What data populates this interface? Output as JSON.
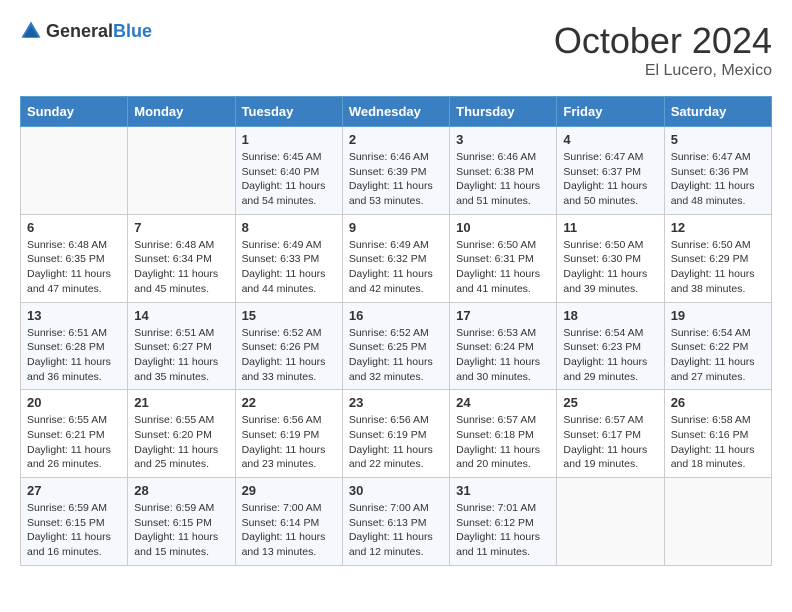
{
  "logo": {
    "text_general": "General",
    "text_blue": "Blue"
  },
  "header": {
    "month": "October 2024",
    "location": "El Lucero, Mexico"
  },
  "weekdays": [
    "Sunday",
    "Monday",
    "Tuesday",
    "Wednesday",
    "Thursday",
    "Friday",
    "Saturday"
  ],
  "weeks": [
    [
      {
        "day": "",
        "info": ""
      },
      {
        "day": "",
        "info": ""
      },
      {
        "day": "1",
        "info": "Sunrise: 6:45 AM\nSunset: 6:40 PM\nDaylight: 11 hours and 54 minutes."
      },
      {
        "day": "2",
        "info": "Sunrise: 6:46 AM\nSunset: 6:39 PM\nDaylight: 11 hours and 53 minutes."
      },
      {
        "day": "3",
        "info": "Sunrise: 6:46 AM\nSunset: 6:38 PM\nDaylight: 11 hours and 51 minutes."
      },
      {
        "day": "4",
        "info": "Sunrise: 6:47 AM\nSunset: 6:37 PM\nDaylight: 11 hours and 50 minutes."
      },
      {
        "day": "5",
        "info": "Sunrise: 6:47 AM\nSunset: 6:36 PM\nDaylight: 11 hours and 48 minutes."
      }
    ],
    [
      {
        "day": "6",
        "info": "Sunrise: 6:48 AM\nSunset: 6:35 PM\nDaylight: 11 hours and 47 minutes."
      },
      {
        "day": "7",
        "info": "Sunrise: 6:48 AM\nSunset: 6:34 PM\nDaylight: 11 hours and 45 minutes."
      },
      {
        "day": "8",
        "info": "Sunrise: 6:49 AM\nSunset: 6:33 PM\nDaylight: 11 hours and 44 minutes."
      },
      {
        "day": "9",
        "info": "Sunrise: 6:49 AM\nSunset: 6:32 PM\nDaylight: 11 hours and 42 minutes."
      },
      {
        "day": "10",
        "info": "Sunrise: 6:50 AM\nSunset: 6:31 PM\nDaylight: 11 hours and 41 minutes."
      },
      {
        "day": "11",
        "info": "Sunrise: 6:50 AM\nSunset: 6:30 PM\nDaylight: 11 hours and 39 minutes."
      },
      {
        "day": "12",
        "info": "Sunrise: 6:50 AM\nSunset: 6:29 PM\nDaylight: 11 hours and 38 minutes."
      }
    ],
    [
      {
        "day": "13",
        "info": "Sunrise: 6:51 AM\nSunset: 6:28 PM\nDaylight: 11 hours and 36 minutes."
      },
      {
        "day": "14",
        "info": "Sunrise: 6:51 AM\nSunset: 6:27 PM\nDaylight: 11 hours and 35 minutes."
      },
      {
        "day": "15",
        "info": "Sunrise: 6:52 AM\nSunset: 6:26 PM\nDaylight: 11 hours and 33 minutes."
      },
      {
        "day": "16",
        "info": "Sunrise: 6:52 AM\nSunset: 6:25 PM\nDaylight: 11 hours and 32 minutes."
      },
      {
        "day": "17",
        "info": "Sunrise: 6:53 AM\nSunset: 6:24 PM\nDaylight: 11 hours and 30 minutes."
      },
      {
        "day": "18",
        "info": "Sunrise: 6:54 AM\nSunset: 6:23 PM\nDaylight: 11 hours and 29 minutes."
      },
      {
        "day": "19",
        "info": "Sunrise: 6:54 AM\nSunset: 6:22 PM\nDaylight: 11 hours and 27 minutes."
      }
    ],
    [
      {
        "day": "20",
        "info": "Sunrise: 6:55 AM\nSunset: 6:21 PM\nDaylight: 11 hours and 26 minutes."
      },
      {
        "day": "21",
        "info": "Sunrise: 6:55 AM\nSunset: 6:20 PM\nDaylight: 11 hours and 25 minutes."
      },
      {
        "day": "22",
        "info": "Sunrise: 6:56 AM\nSunset: 6:19 PM\nDaylight: 11 hours and 23 minutes."
      },
      {
        "day": "23",
        "info": "Sunrise: 6:56 AM\nSunset: 6:19 PM\nDaylight: 11 hours and 22 minutes."
      },
      {
        "day": "24",
        "info": "Sunrise: 6:57 AM\nSunset: 6:18 PM\nDaylight: 11 hours and 20 minutes."
      },
      {
        "day": "25",
        "info": "Sunrise: 6:57 AM\nSunset: 6:17 PM\nDaylight: 11 hours and 19 minutes."
      },
      {
        "day": "26",
        "info": "Sunrise: 6:58 AM\nSunset: 6:16 PM\nDaylight: 11 hours and 18 minutes."
      }
    ],
    [
      {
        "day": "27",
        "info": "Sunrise: 6:59 AM\nSunset: 6:15 PM\nDaylight: 11 hours and 16 minutes."
      },
      {
        "day": "28",
        "info": "Sunrise: 6:59 AM\nSunset: 6:15 PM\nDaylight: 11 hours and 15 minutes."
      },
      {
        "day": "29",
        "info": "Sunrise: 7:00 AM\nSunset: 6:14 PM\nDaylight: 11 hours and 13 minutes."
      },
      {
        "day": "30",
        "info": "Sunrise: 7:00 AM\nSunset: 6:13 PM\nDaylight: 11 hours and 12 minutes."
      },
      {
        "day": "31",
        "info": "Sunrise: 7:01 AM\nSunset: 6:12 PM\nDaylight: 11 hours and 11 minutes."
      },
      {
        "day": "",
        "info": ""
      },
      {
        "day": "",
        "info": ""
      }
    ]
  ]
}
